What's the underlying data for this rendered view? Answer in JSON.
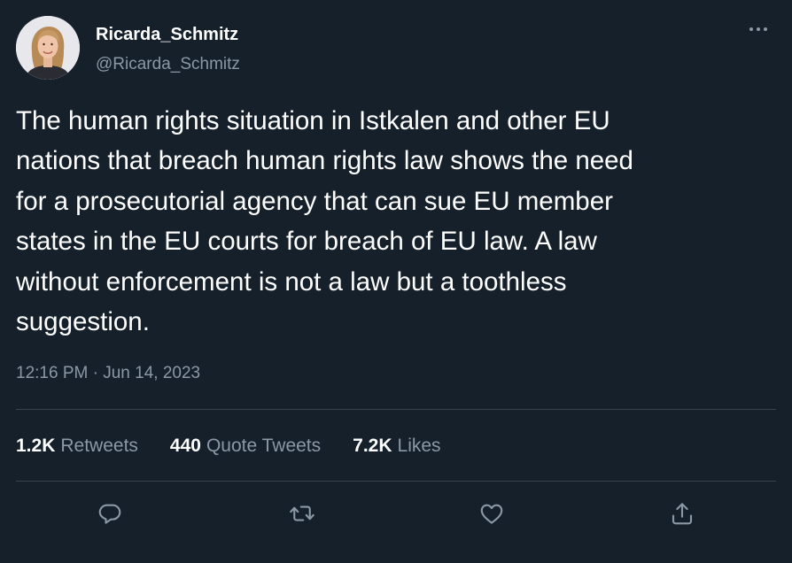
{
  "author": {
    "display_name": "Ricarda_Schmitz",
    "handle": "@Ricarda_Schmitz",
    "avatar_icon": "profile-photo"
  },
  "more_icon": "more-horizontal-icon",
  "tweet": {
    "text": "The human rights situation in Istkalen and other EU\nnations that breach human rights law shows the need\nfor a prosecutorial agency that can sue EU member\nstates in the EU courts for breach of EU law. A law\nwithout enforcement is not a law but a toothless\nsuggestion.",
    "timestamp": "12:16 PM · Jun 14, 2023"
  },
  "stats": {
    "retweets": {
      "count": "1.2K",
      "label": "Retweets"
    },
    "quote_tweets": {
      "count": "440",
      "label": "Quote Tweets"
    },
    "likes": {
      "count": "7.2K",
      "label": "Likes"
    }
  },
  "actions": {
    "reply_icon": "reply-icon",
    "retweet_icon": "retweet-icon",
    "like_icon": "heart-icon",
    "share_icon": "share-icon"
  },
  "colors": {
    "background": "#15202b",
    "primary_text": "#ffffff",
    "secondary_text": "#8b98a5",
    "divider": "#38444d"
  }
}
